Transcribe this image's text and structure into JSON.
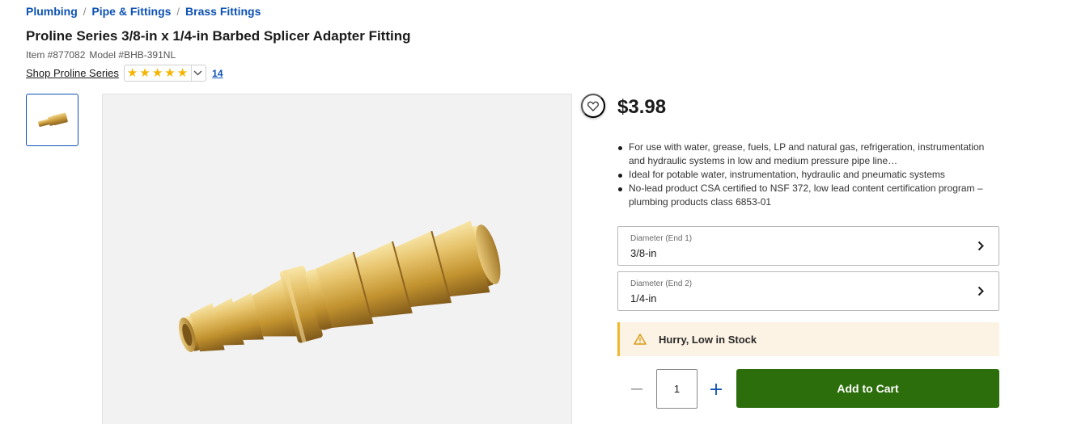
{
  "breadcrumb": [
    "Plumbing",
    "Pipe & Fittings",
    "Brass Fittings"
  ],
  "product": {
    "title": "Proline Series 3/8-in x 1/4-in Barbed Splicer Adapter Fitting",
    "item_label": "Item #877082",
    "model_label": "Model #BHB-391NL",
    "shop_link": "Shop Proline Series",
    "rating_stars": 5,
    "review_count": "14",
    "price": "$3.98"
  },
  "features": [
    "For use with water, grease, fuels, LP and natural gas, refrigeration, instrumentation and hydraulic systems in low and medium pressure pipe line…",
    "Ideal for potable water, instrumentation, hydraulic and pneumatic systems",
    "No-lead product CSA certified to NSF 372, low lead content certification program – plumbing products class 6853-01"
  ],
  "selectors": [
    {
      "label": "Diameter (End 1)",
      "value": "3/8-in"
    },
    {
      "label": "Diameter (End 2)",
      "value": "1/4-in"
    }
  ],
  "stock": {
    "message": "Hurry, Low in Stock"
  },
  "cart": {
    "quantity": "1",
    "add_label": "Add to Cart"
  },
  "icons": {
    "favorite": "heart-icon",
    "star": "star-icon",
    "ratings_toggle": "chevron-down-icon",
    "selector_arrow": "chevron-right-icon",
    "warning": "warning-icon",
    "minus": "minus-icon",
    "plus": "plus-icon"
  },
  "colors": {
    "link_blue": "#0d52b3",
    "star_gold": "#f4b400",
    "cart_green": "#2d6e0c",
    "stock_bg": "#fdf3e4",
    "stock_accent": "#f1b82d"
  }
}
